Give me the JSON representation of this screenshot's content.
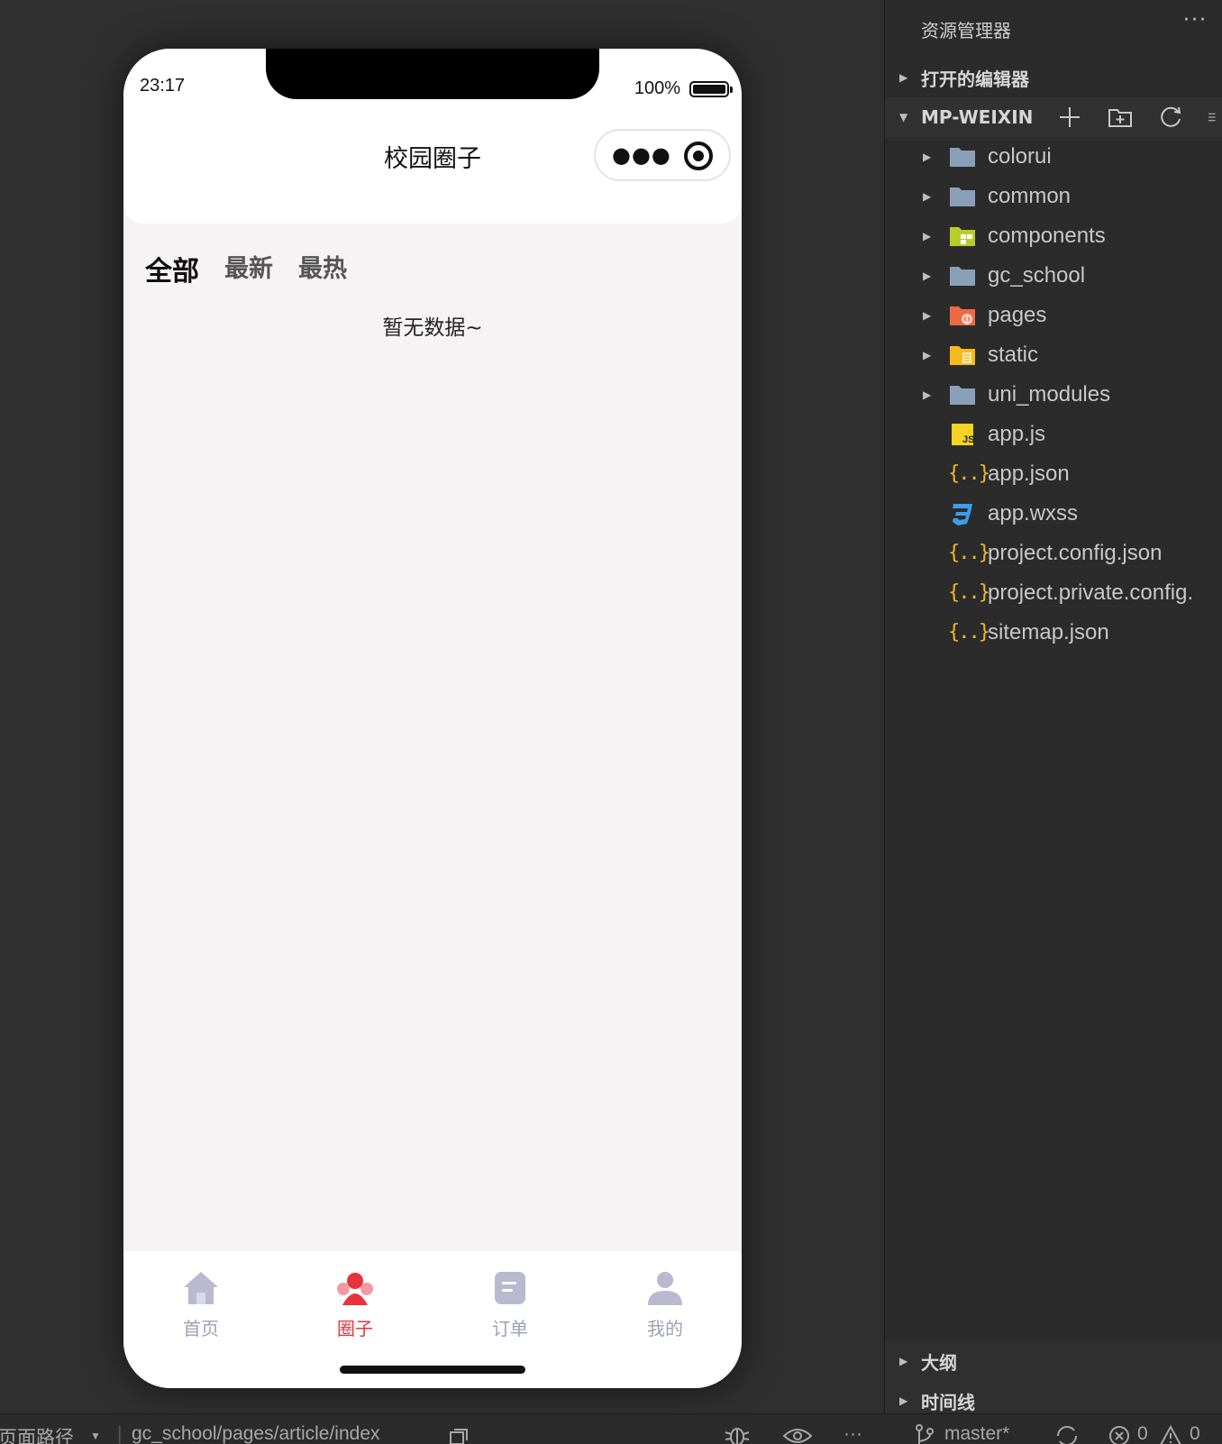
{
  "phone": {
    "status_time": "23:17",
    "battery_text": "100%",
    "page_title": "校园圈子",
    "capsule_more_icon": "more-dots-icon",
    "capsule_close_icon": "target-circle-icon",
    "tabs": [
      {
        "label": "全部",
        "active": true
      },
      {
        "label": "最新",
        "active": false
      },
      {
        "label": "最热",
        "active": false
      }
    ],
    "empty_text": "暂无数据~",
    "tabbar": [
      {
        "label": "首页",
        "icon": "home-icon",
        "active": false
      },
      {
        "label": "圈子",
        "icon": "circle-group-icon",
        "active": true
      },
      {
        "label": "订单",
        "icon": "order-icon",
        "active": false
      },
      {
        "label": "我的",
        "icon": "user-icon",
        "active": false
      }
    ],
    "colors": {
      "accent": "#e8323c",
      "tab_underline": "#ee4d2d",
      "inactive": "#9d9fb8",
      "page_bg": "#f7f3f4"
    }
  },
  "explorer": {
    "title": "资源管理器",
    "more": "···",
    "open_editors": "打开的编辑器",
    "root": "MP-WEIXIN",
    "items": [
      {
        "name": "colorui",
        "type": "folder",
        "icon": "folder-icon"
      },
      {
        "name": "common",
        "type": "folder",
        "icon": "folder-icon"
      },
      {
        "name": "components",
        "type": "folder",
        "icon": "components-folder-icon"
      },
      {
        "name": "gc_school",
        "type": "folder",
        "icon": "folder-icon"
      },
      {
        "name": "pages",
        "type": "folder",
        "icon": "pages-folder-icon"
      },
      {
        "name": "static",
        "type": "folder",
        "icon": "static-folder-icon"
      },
      {
        "name": "uni_modules",
        "type": "folder",
        "icon": "folder-icon"
      },
      {
        "name": "app.js",
        "type": "file",
        "icon": "js-file-icon"
      },
      {
        "name": "app.json",
        "type": "file",
        "icon": "json-file-icon"
      },
      {
        "name": "app.wxss",
        "type": "file",
        "icon": "css-file-icon"
      },
      {
        "name": "project.config.json",
        "type": "file",
        "icon": "json-file-icon"
      },
      {
        "name": "project.private.config.",
        "type": "file",
        "icon": "json-file-icon"
      },
      {
        "name": "sitemap.json",
        "type": "file",
        "icon": "json-file-icon"
      }
    ],
    "outline": "大纲",
    "timeline": "时间线"
  },
  "statusbar": {
    "page_path_label": "页面路径",
    "path": "gc_school/pages/article/index",
    "branch": "master*",
    "errors": "0",
    "warnings": "0"
  }
}
